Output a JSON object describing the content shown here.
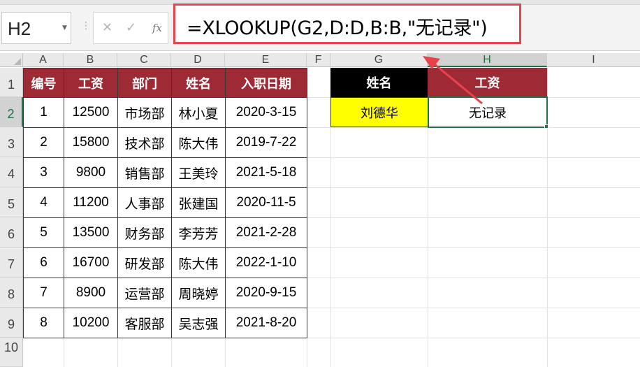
{
  "name_box": {
    "value": "H2"
  },
  "formula_bar": {
    "cancel_glyph": "✕",
    "enter_glyph": "✓",
    "fx_label": "fx",
    "formula": "=XLOOKUP(G2,D:D,B:B,\"无记录\")"
  },
  "columns": [
    "A",
    "B",
    "C",
    "D",
    "E",
    "F",
    "G",
    "H",
    "I"
  ],
  "rows": [
    "1",
    "2",
    "3",
    "4",
    "5",
    "6",
    "7",
    "8",
    "9",
    "10"
  ],
  "table": {
    "headers": [
      "编号",
      "工资",
      "部门",
      "姓名",
      "入职日期"
    ],
    "rows": [
      [
        "1",
        "12500",
        "市场部",
        "林小夏",
        "2020-3-15"
      ],
      [
        "2",
        "15800",
        "技术部",
        "陈大伟",
        "2019-7-22"
      ],
      [
        "3",
        "9800",
        "销售部",
        "王美玲",
        "2021-5-18"
      ],
      [
        "4",
        "11200",
        "人事部",
        "张建国",
        "2020-11-5"
      ],
      [
        "5",
        "13500",
        "财务部",
        "李芳芳",
        "2021-2-28"
      ],
      [
        "6",
        "16700",
        "研发部",
        "陈大伟",
        "2022-1-10"
      ],
      [
        "7",
        "8900",
        "运营部",
        "周晓婷",
        "2020-9-15"
      ],
      [
        "8",
        "10200",
        "客服部",
        "吴志强",
        "2021-8-20"
      ]
    ]
  },
  "lookup": {
    "name_header": "姓名",
    "salary_header": "工资",
    "name_value": "刘德华",
    "result_value": "无记录"
  },
  "colors": {
    "header_red": "#9e2a35",
    "highlight_yellow": "#ffff00",
    "annotation_red": "#e8434c",
    "excel_green": "#217346"
  }
}
